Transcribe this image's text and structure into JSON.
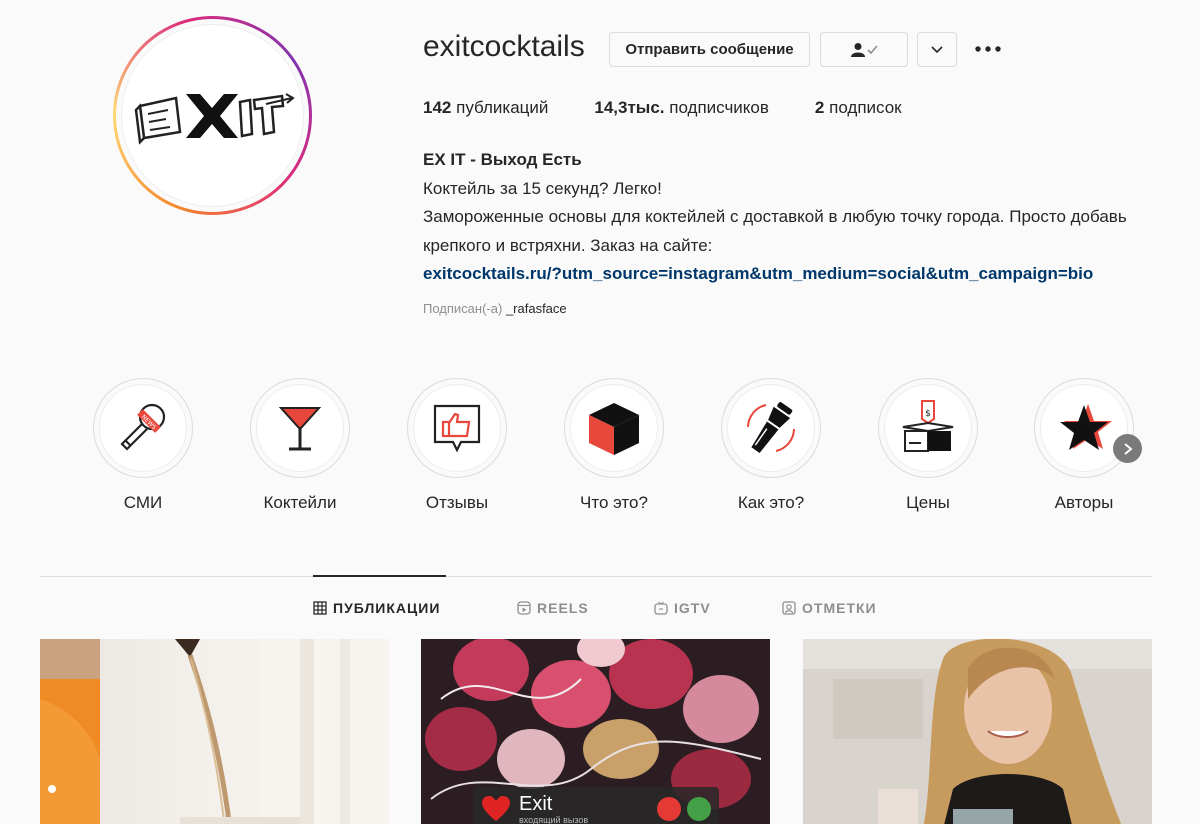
{
  "profile": {
    "username": "exitcocktails",
    "message_label": "Отправить сообщение",
    "stats": {
      "posts_value": "142",
      "posts_label": "публикаций",
      "followers_value": "14,3тыс.",
      "followers_label": "подписчиков",
      "following_value": "2",
      "following_label": "подписок"
    },
    "bio": {
      "name": "EX IT - Выход Есть",
      "line1": "Коктейль за 15 секунд? Легко!",
      "line2": "Замороженные основы для коктейлей с доставкой в любую точку города. Просто добавь крепкого и встряхни. Заказ на сайте:",
      "link": "exitcocktails.ru/?utm_source=instagram&utm_medium=social&utm_campaign=bio"
    },
    "followed_by_label": "Подписан(-а)",
    "followed_by_user": "_rafasface"
  },
  "highlights": [
    {
      "label": "СМИ",
      "icon": "news-microphone-icon"
    },
    {
      "label": "Коктейли",
      "icon": "cocktail-glass-icon"
    },
    {
      "label": "Отзывы",
      "icon": "thumbs-up-icon"
    },
    {
      "label": "Что это?",
      "icon": "cube-icon"
    },
    {
      "label": "Как это?",
      "icon": "shaker-icon"
    },
    {
      "label": "Цены",
      "icon": "price-box-icon"
    },
    {
      "label": "Авторы",
      "icon": "star-icon"
    }
  ],
  "tabs": [
    {
      "label": "ПУБЛИКАЦИИ",
      "icon": "grid-icon",
      "active": true
    },
    {
      "label": "REELS",
      "icon": "reels-icon",
      "active": false
    },
    {
      "label": "IGTV",
      "icon": "igtv-icon",
      "active": false
    },
    {
      "label": "ОТМЕТКИ",
      "icon": "tagged-icon",
      "active": false
    }
  ],
  "posts": {
    "post2_caller": "Exit",
    "post2_caller_sub": "входящий вызов"
  },
  "colors": {
    "link": "#00376b",
    "accent_red": "#e8473b",
    "text": "#262626",
    "muted": "#8e8e8e"
  }
}
